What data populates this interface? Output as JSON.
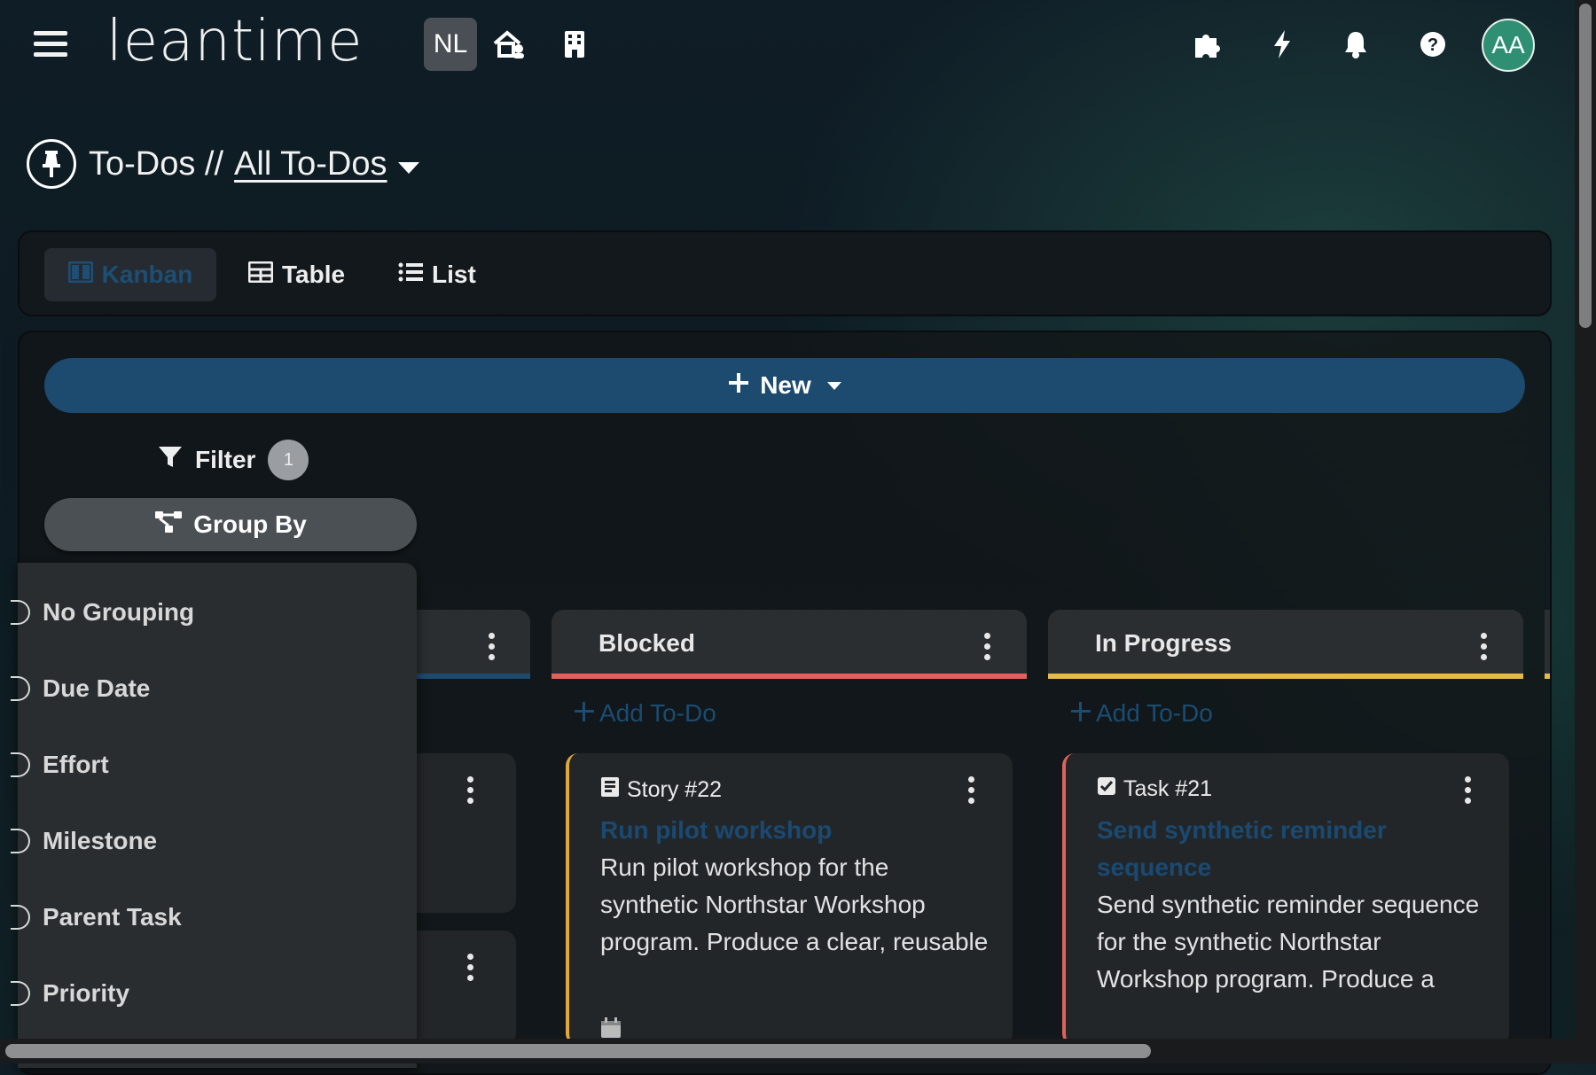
{
  "header": {
    "logo_text": "leantime",
    "project_badge": "NL",
    "avatar_initials": "AA",
    "icons": [
      "menu-icon",
      "house-user-icon",
      "building-icon",
      "puzzle-icon",
      "bolt-icon",
      "bell-icon",
      "help-icon"
    ]
  },
  "breadcrumb": {
    "section": "To-Dos //",
    "current_view": "All To-Dos"
  },
  "view_tabs": [
    {
      "label": "Kanban",
      "active": true
    },
    {
      "label": "Table",
      "active": false
    },
    {
      "label": "List",
      "active": false
    }
  ],
  "toolbar": {
    "new_label": "New",
    "filter_label": "Filter",
    "filter_count": "1",
    "group_by_label": "Group By"
  },
  "group_by_options": [
    "No Grouping",
    "Due Date",
    "Effort",
    "Milestone",
    "Parent Task",
    "Priority"
  ],
  "columns": [
    {
      "title": "Blocked",
      "bar_color": "#e0625a",
      "add_label": "Add To-Do",
      "card": {
        "type_label": "Story #22",
        "title": "Run pilot workshop",
        "description": "Run pilot workshop for the synthetic Northstar Workshop program. Produce a clear, reusable artifact for Demo Cooperative and",
        "accent": "#e0a83a"
      }
    },
    {
      "title": "In Progress",
      "bar_color": "#e7b84a",
      "add_label": "Add To-Do",
      "card": {
        "type_label": "Task #21",
        "title": "Send synthetic reminder sequence",
        "description": "Send synthetic reminder sequence for the synthetic Northstar Workshop program. Produce a clear, reusable artifact for Demo",
        "accent": "#e0625a"
      }
    }
  ],
  "colors": {
    "primary": "#1d4a6f",
    "link": "#1a4a72",
    "avatar": "#2f8f72"
  }
}
